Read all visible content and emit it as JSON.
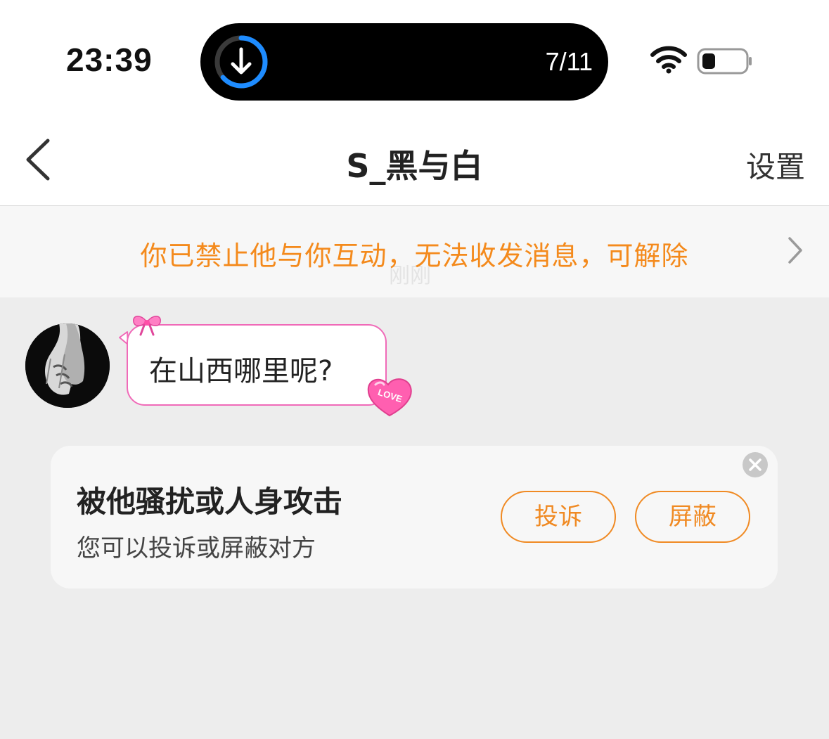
{
  "status_bar": {
    "time": "23:39",
    "download_progress": "7/11",
    "wifi_icon": "wifi-icon",
    "battery_icon": "battery-icon"
  },
  "nav": {
    "back_icon": "chevron-left-icon",
    "title": "S_黑与白",
    "settings_label": "设置"
  },
  "banner": {
    "text": "你已禁止他与你互动，无法收发消息，可解除",
    "timestamp_ghost": "刚刚",
    "arrow_icon": "chevron-right-icon"
  },
  "messages": [
    {
      "sender": "other",
      "text": "在山西哪里呢?"
    }
  ],
  "safety_card": {
    "title": "被他骚扰或人身攻击",
    "subtitle": "您可以投诉或屏蔽对方",
    "report_label": "投诉",
    "block_label": "屏蔽",
    "close_icon": "close-icon"
  },
  "colors": {
    "accent_orange": "#f48a1c",
    "bubble_border": "#f06ab8",
    "download_ring": "#1e8cff",
    "background": "#ededed"
  }
}
